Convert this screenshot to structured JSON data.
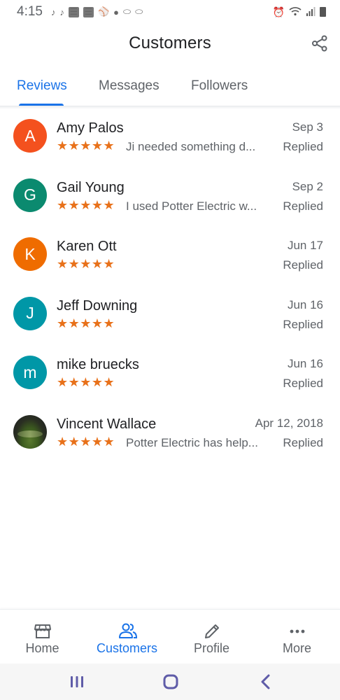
{
  "status_bar": {
    "time": "4:15"
  },
  "app_bar": {
    "title": "Customers"
  },
  "tabs": [
    {
      "label": "Reviews",
      "active": true
    },
    {
      "label": "Messages",
      "active": false
    },
    {
      "label": "Followers",
      "active": false
    }
  ],
  "reviews": [
    {
      "initial": "A",
      "avatar_color": "#f4511e",
      "name": "Amy Palos",
      "date": "Sep 3",
      "stars": "★★★★★",
      "snippet": "Ji needed something d...",
      "status": "Replied"
    },
    {
      "initial": "G",
      "avatar_color": "#0b8a6f",
      "name": "Gail Young",
      "date": "Sep 2",
      "stars": "★★★★★",
      "snippet": "I used Potter Electric w...",
      "status": "Replied"
    },
    {
      "initial": "K",
      "avatar_color": "#ef6c00",
      "name": "Karen Ott",
      "date": "Jun 17",
      "stars": "★★★★★",
      "snippet": "",
      "status": "Replied"
    },
    {
      "initial": "J",
      "avatar_color": "#0097a7",
      "name": "Jeff Downing",
      "date": "Jun 16",
      "stars": "★★★★★",
      "snippet": "",
      "status": "Replied"
    },
    {
      "initial": "m",
      "avatar_color": "#0097a7",
      "name": "mike bruecks",
      "date": "Jun 16",
      "stars": "★★★★★",
      "snippet": "",
      "status": "Replied"
    },
    {
      "initial": "",
      "avatar_color": "#2a2f22",
      "name": "Vincent Wallace",
      "date": "Apr 12, 2018",
      "stars": "★★★★★",
      "snippet": "Potter Electric has help...",
      "status": "Replied"
    }
  ],
  "bottom_nav": [
    {
      "label": "Home",
      "icon": "storefront-icon",
      "active": false
    },
    {
      "label": "Customers",
      "icon": "people-icon",
      "active": true
    },
    {
      "label": "Profile",
      "icon": "pencil-icon",
      "active": false
    },
    {
      "label": "More",
      "icon": "more-dots-icon",
      "active": false
    }
  ],
  "colors": {
    "accent": "#1a73e8",
    "star": "#e8711a",
    "secondary_text": "#5f6368"
  }
}
